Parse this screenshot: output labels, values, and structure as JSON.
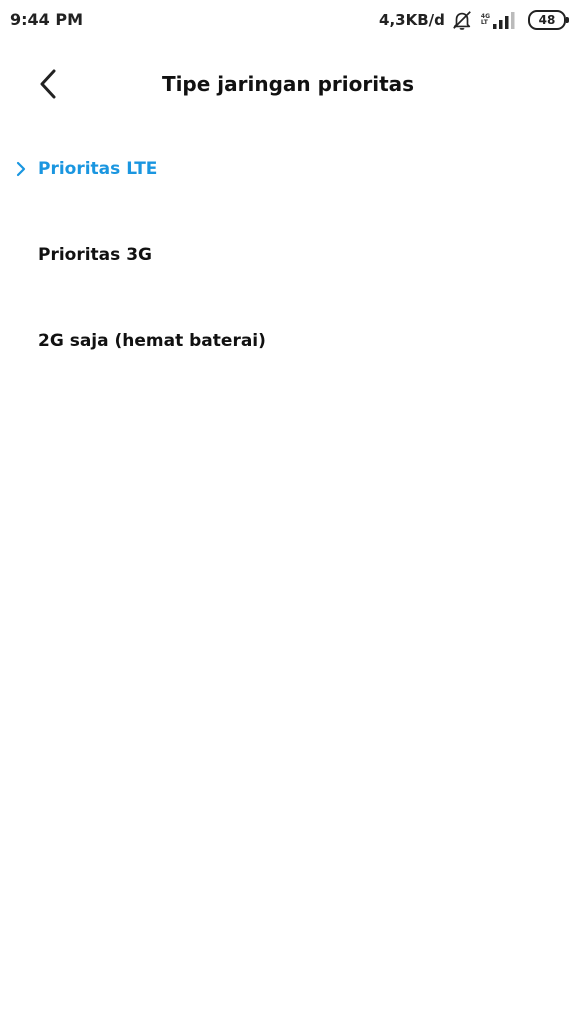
{
  "status_bar": {
    "time": "9:44 PM",
    "net_speed": "4,3KB/d",
    "net_type_top": "4G",
    "net_type_bottom": "LT",
    "battery": "48"
  },
  "header": {
    "title": "Tipe jaringan prioritas"
  },
  "options": [
    {
      "label": "Prioritas LTE",
      "selected": true
    },
    {
      "label": "Prioritas 3G",
      "selected": false
    },
    {
      "label": "2G saja (hemat baterai)",
      "selected": false
    }
  ],
  "colors": {
    "accent": "#1a96e0",
    "text": "#111111",
    "background": "#ffffff"
  },
  "icons": {
    "back": "chevron-left-icon",
    "selected": "chevron-right-icon",
    "mute": "bell-off-icon",
    "signal": "signal-icon"
  }
}
